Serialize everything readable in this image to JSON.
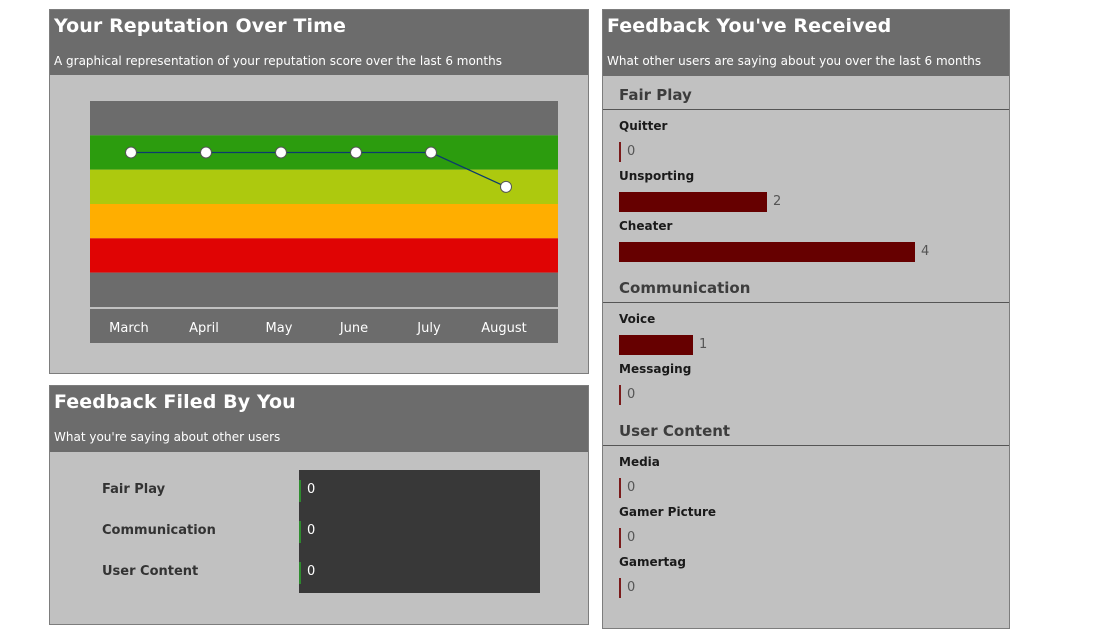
{
  "reputation": {
    "title": "Your Reputation Over Time",
    "subtitle": "A graphical representation of your reputation score over the last 6 months"
  },
  "chart_data": {
    "type": "line",
    "categories": [
      "March",
      "April",
      "May",
      "June",
      "July",
      "August"
    ],
    "values": [
      4.5,
      4.5,
      4.5,
      4.5,
      4.5,
      3.5
    ],
    "ylim": [
      0,
      6
    ],
    "bands": [
      {
        "from": 5,
        "to": 6,
        "color": "#6c6c6c"
      },
      {
        "from": 4,
        "to": 5,
        "color": "#2c9c0e"
      },
      {
        "from": 3,
        "to": 4,
        "color": "#adc90e"
      },
      {
        "from": 2,
        "to": 3,
        "color": "#ffae00"
      },
      {
        "from": 1,
        "to": 2,
        "color": "#e00404"
      },
      {
        "from": 0,
        "to": 1,
        "color": "#6c6c6c"
      }
    ],
    "line_color": "#0c3a6e",
    "marker_color": "#ffffff",
    "grid": false
  },
  "filed": {
    "title": "Feedback Filed By You",
    "subtitle": "What you're saying about other users",
    "rows": [
      {
        "label": "Fair Play",
        "value": "0"
      },
      {
        "label": "Communication",
        "value": "0"
      },
      {
        "label": "User Content",
        "value": "0"
      }
    ]
  },
  "received": {
    "title": "Feedback You've Received",
    "subtitle": "What other users are saying about you over the last 6 months",
    "max": 4,
    "sections": [
      {
        "title": "Fair Play",
        "items": [
          {
            "label": "Quitter",
            "count": 0
          },
          {
            "label": "Unsporting",
            "count": 2
          },
          {
            "label": "Cheater",
            "count": 4
          }
        ]
      },
      {
        "title": "Communication",
        "items": [
          {
            "label": "Voice",
            "count": 1
          },
          {
            "label": "Messaging",
            "count": 0
          }
        ]
      },
      {
        "title": "User Content",
        "items": [
          {
            "label": "Media",
            "count": 0
          },
          {
            "label": "Gamer Picture",
            "count": 0
          },
          {
            "label": "Gamertag",
            "count": 0
          }
        ]
      }
    ]
  },
  "colors": {
    "header_bg": "#6c6c6c",
    "panel_bg": "#c1c1c1",
    "received_bar": "#660000",
    "filed_box": "#383838",
    "filed_bar": "#2e8b2e"
  }
}
